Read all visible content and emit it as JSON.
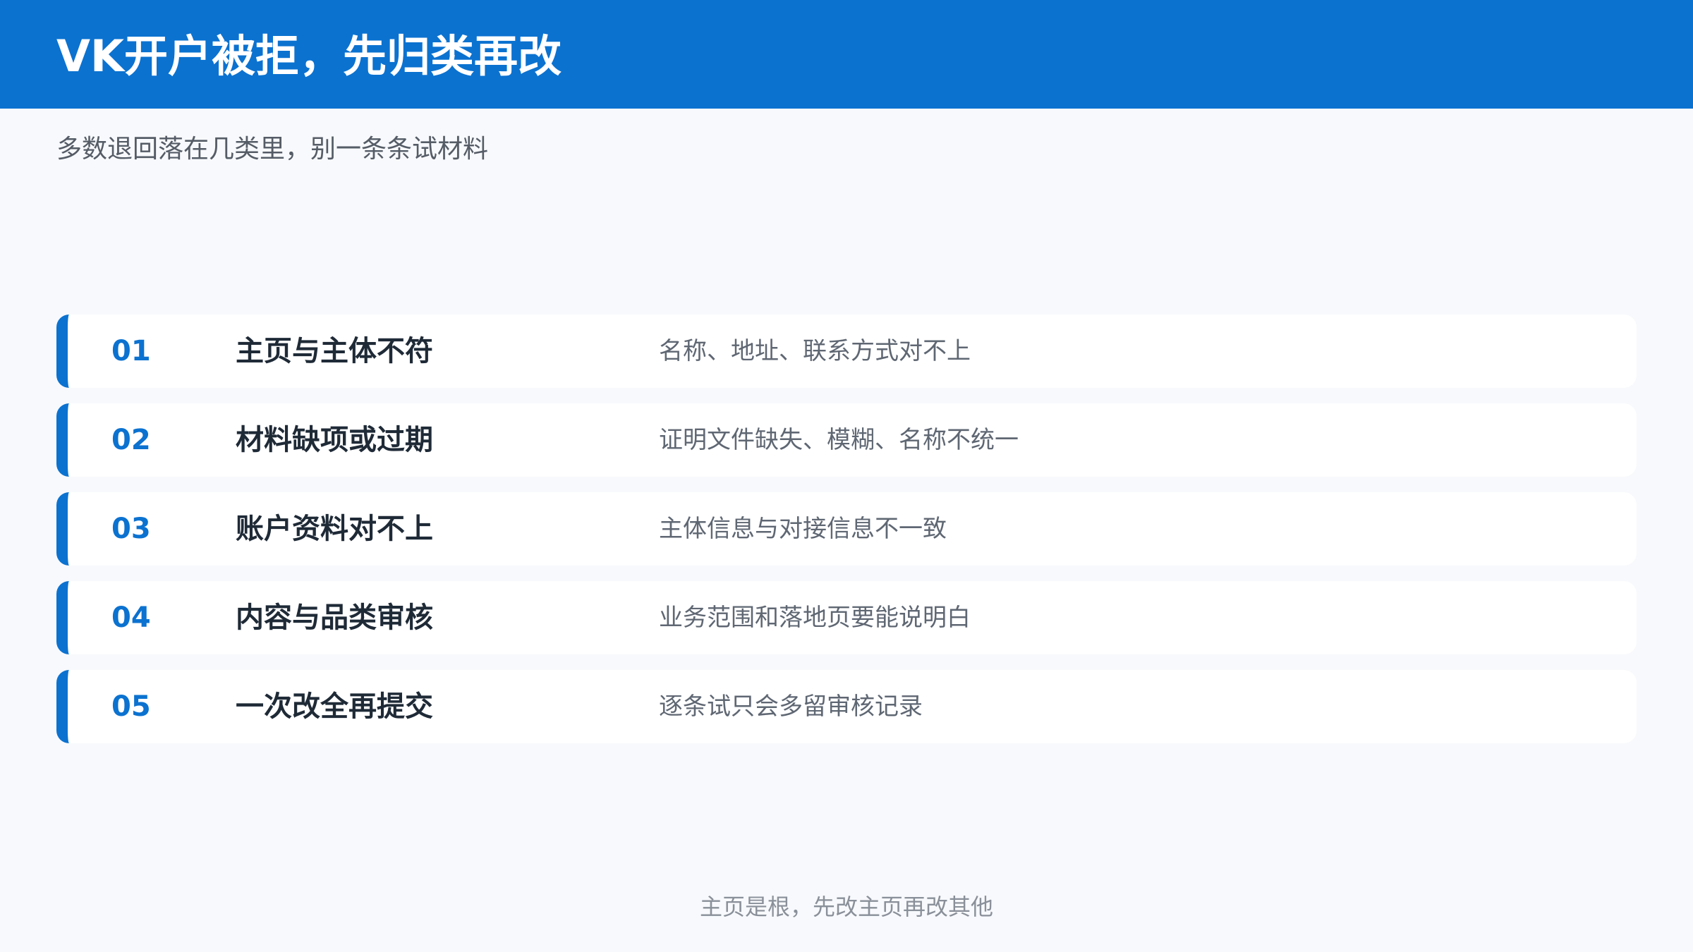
{
  "header": {
    "title": "VK开户被拒，先归类再改",
    "subtitle": "多数退回落在几类里，别一条条试材料"
  },
  "items": [
    {
      "num": "01",
      "title": "主页与主体不符",
      "desc": "名称、地址、联系方式对不上"
    },
    {
      "num": "02",
      "title": "材料缺项或过期",
      "desc": "证明文件缺失、模糊、名称不统一"
    },
    {
      "num": "03",
      "title": "账户资料对不上",
      "desc": "主体信息与对接信息不一致"
    },
    {
      "num": "04",
      "title": "内容与品类审核",
      "desc": "业务范围和落地页要能说明白"
    },
    {
      "num": "05",
      "title": "一次改全再提交",
      "desc": "逐条试只会多留审核记录"
    }
  ],
  "footer": {
    "note": "主页是根，先改主页再改其他"
  },
  "colors": {
    "accent": "#0b72d0",
    "background": "#f7f9fc",
    "card": "#ffffff",
    "title_text": "#1f2a37",
    "desc_text": "#5f6773"
  }
}
